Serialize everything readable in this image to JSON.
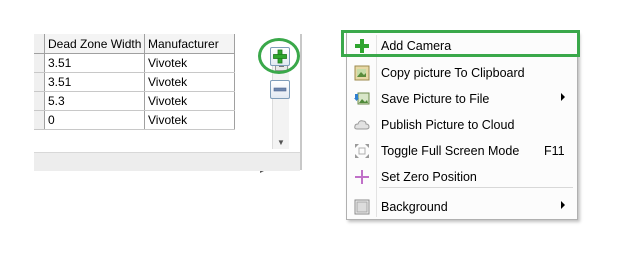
{
  "grid": {
    "columns": [
      "Dead Zone Width",
      "Manufacturer"
    ],
    "rows": [
      [
        "3.51",
        "Vivotek"
      ],
      [
        "3.51",
        "Vivotek"
      ],
      [
        "5.3",
        "Vivotek"
      ],
      [
        "0",
        "Vivotek"
      ]
    ]
  },
  "buttons": {
    "add_icon": "plus-icon",
    "remove_icon": "minus-icon"
  },
  "menu": {
    "items": [
      {
        "label": "Add Camera",
        "icon": "green-plus-icon"
      },
      {
        "label": "Copy picture To Clipboard",
        "icon": "clipboard-icon"
      },
      {
        "label": "Save Picture to File",
        "icon": "save-picture-icon",
        "submenu": true
      },
      {
        "label": "Publish Picture to Cloud",
        "icon": "cloud-icon"
      },
      {
        "label": "Toggle Full Screen Mode",
        "icon": "fullscreen-icon",
        "shortcut": "F11"
      },
      {
        "label": "Set Zero Position",
        "icon": "purple-plus-icon"
      },
      {
        "label": "Background",
        "icon": "background-icon",
        "submenu": true
      }
    ]
  },
  "colors": {
    "highlight_green": "#3aa84a",
    "plus_green": "#2fa52f",
    "zero_purple": "#c070c8"
  }
}
